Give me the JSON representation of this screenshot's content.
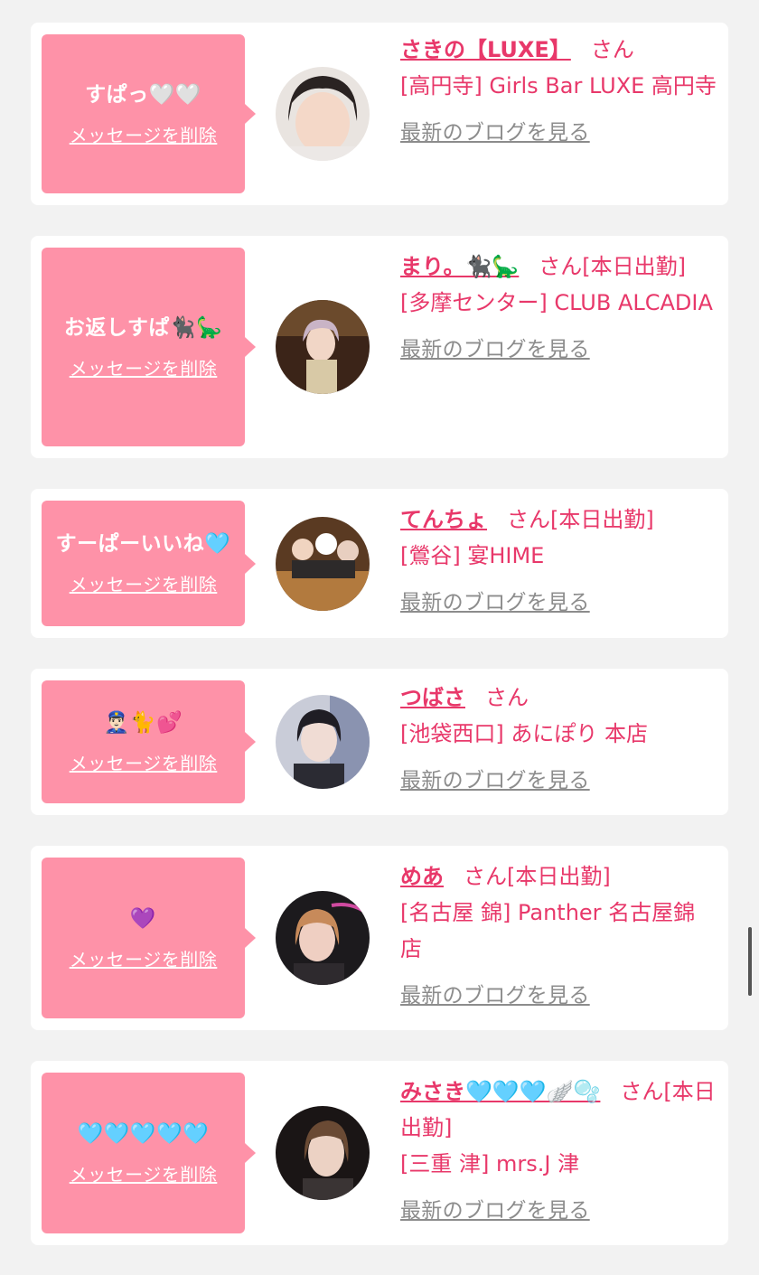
{
  "delete_label": "メッセージを削除",
  "blog_label": "最新のブログを見る",
  "san_label": "さん",
  "accent_color": "#fe92a8",
  "text_color": "#e8386a",
  "items": [
    {
      "message": "すぱっ🤍🤍",
      "name": "さきの【LUXE】",
      "status": "",
      "shop": "[高円寺] Girls Bar LUXE 高円寺"
    },
    {
      "message": "お返しすぱ🐈‍⬛🦕",
      "name": "まり。🐈‍⬛🦕",
      "status": "[本日出勤]",
      "shop": "[多摩センター] CLUB ALCADIA"
    },
    {
      "message": "すーぱーいいね🩵",
      "name": "てんちょ",
      "status": "[本日出勤]",
      "shop": "[鶯谷] 宴HIME"
    },
    {
      "message": "👮🏻‍♂️🐈💕",
      "name": "つばさ",
      "status": "",
      "shop": "[池袋西口] あにぽり 本店"
    },
    {
      "message": "💜",
      "name": "めあ",
      "status": "[本日出勤]",
      "shop": "[名古屋 錦] Panther 名古屋錦店"
    },
    {
      "message": "🩵🩵🩵🩵🩵",
      "name": "みさき🩵🩵🩵🪽🫧",
      "status": "[本日出勤]",
      "shop": "[三重 津] mrs.J 津"
    }
  ]
}
